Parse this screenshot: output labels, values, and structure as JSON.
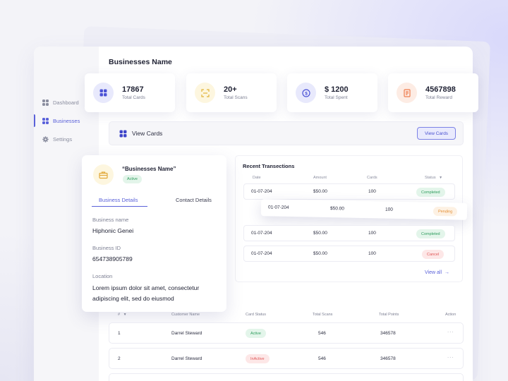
{
  "header": {
    "title": "Businesses Name"
  },
  "sidebar": {
    "items": [
      {
        "label": "Dashboard",
        "icon": "dashboard-icon",
        "active": false
      },
      {
        "label": "Businesses",
        "icon": "businesses-icon",
        "active": true
      },
      {
        "label": "Settings",
        "icon": "gear-icon",
        "active": false
      }
    ]
  },
  "stats": [
    {
      "value": "17867",
      "label": "Total Cards",
      "icon": "cards-icon",
      "color": "#4b52d6",
      "bg": "#e8e9fc"
    },
    {
      "value": "20+",
      "label": "Total Scans",
      "icon": "scan-icon",
      "color": "#e2b53a",
      "bg": "#fdf6df"
    },
    {
      "value": "$ 1200",
      "label": "Total Spent",
      "icon": "dollar-icon",
      "color": "#4b52d6",
      "bg": "#e8e9fc"
    },
    {
      "value": "4567898",
      "label": "Total Reward",
      "icon": "reward-icon",
      "color": "#ee7d4e",
      "bg": "#fdece4"
    }
  ],
  "view_cards": {
    "title": "View Cards",
    "button": "View Cards"
  },
  "transactions": {
    "title": "Recent Transections",
    "headers": {
      "date": "Date",
      "amount": "Amount",
      "cards": "Cards",
      "status": "Status"
    },
    "rows": [
      {
        "date": "01-07-204",
        "amount": "$50.00",
        "cards": "100",
        "status": "Completed",
        "status_color": "green"
      },
      {
        "date": "01-07-204",
        "amount": "$50.00",
        "cards": "100",
        "status": "Pending",
        "status_color": "orange"
      },
      {
        "date": "01-07-204",
        "amount": "$50.00",
        "cards": "100",
        "status": "Completed",
        "status_color": "green"
      },
      {
        "date": "01-07-204",
        "amount": "$50.00",
        "cards": "100",
        "status": "Cancel",
        "status_color": "red"
      }
    ],
    "view_all": "View all"
  },
  "detail": {
    "name": "“Businesses Name”",
    "status": "Active",
    "tabs": {
      "business": "Business Details",
      "contact": "Contact Details"
    },
    "fields": {
      "business_name_label": "Business name",
      "business_name_value": "Hiphonic Genei",
      "business_id_label": "Business ID",
      "business_id_value": "654738905789",
      "location_label": "Location",
      "location_value": "Lorem ipsum dolor sit amet, consectetur adipiscing elit, sed do eiusmod"
    }
  },
  "customers": {
    "headers": {
      "num": "#",
      "name": "Customer Name",
      "card_status": "Card Status",
      "scans": "Total Scans",
      "points": "Total Points",
      "action": "Action"
    },
    "rows": [
      {
        "num": "1",
        "name": "Darrel Steward",
        "card_status": "Active",
        "scans": "546",
        "points": "346578",
        "action": "···"
      },
      {
        "num": "2",
        "name": "Darrel Steward",
        "card_status": "InActive",
        "scans": "546",
        "points": "346578",
        "action": "···"
      }
    ]
  }
}
